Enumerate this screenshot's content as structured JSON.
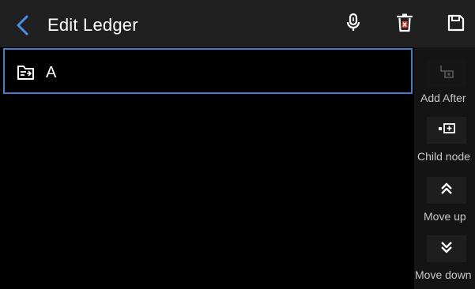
{
  "header": {
    "title": "Edit Ledger",
    "icons": [
      "back-chevron-icon",
      "microphone-icon",
      "delete-icon",
      "save-icon"
    ],
    "colors": {
      "bar": "#202020",
      "accent": "#4a90e2",
      "delete": "#e53935"
    }
  },
  "ledger": {
    "value": "A",
    "icon": "ledger-folder-icon",
    "border_color": "#3f7fc9"
  },
  "side_actions": [
    {
      "label": "Add After",
      "icon": "add-after-icon",
      "enabled": false
    },
    {
      "label": "Child node",
      "icon": "child-node-icon",
      "enabled": true
    },
    {
      "label": "Move up",
      "icon": "chevron-double-up-icon",
      "enabled": true
    },
    {
      "label": "Move down",
      "icon": "chevron-double-down-icon",
      "enabled": true
    }
  ]
}
